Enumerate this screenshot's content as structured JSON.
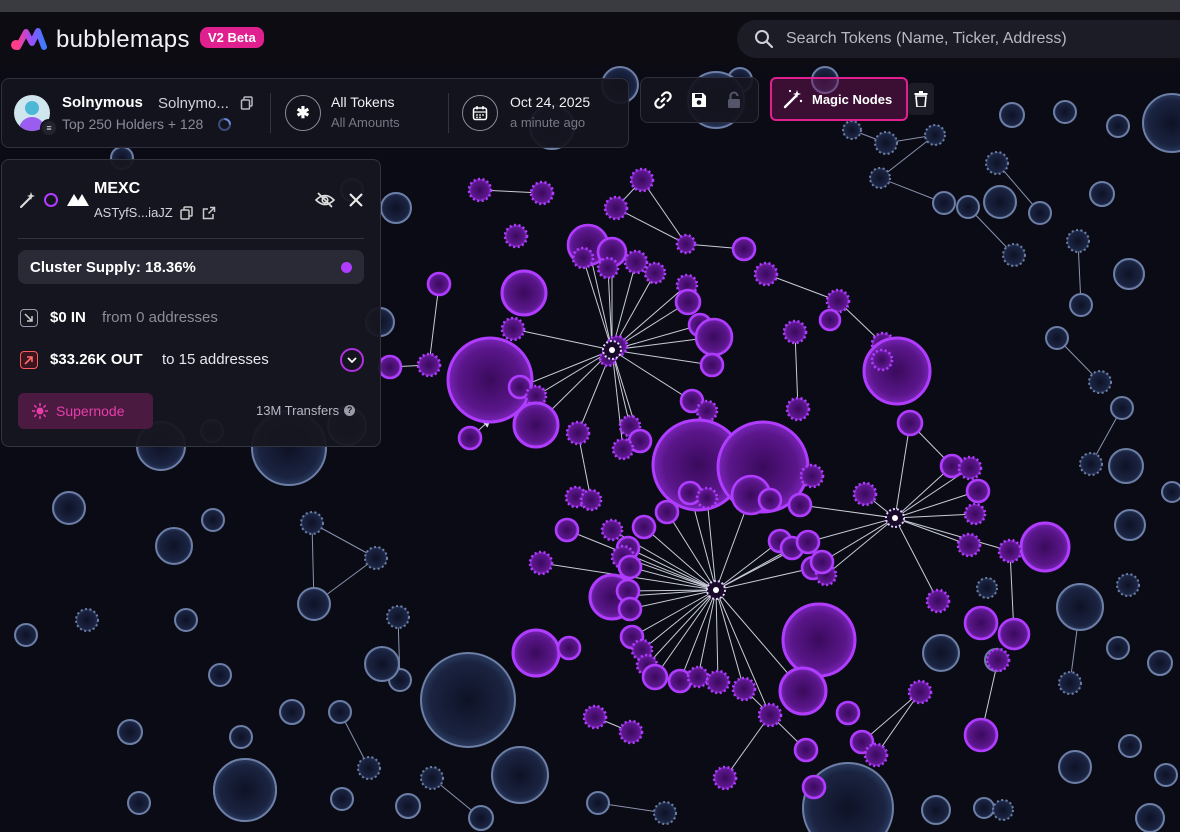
{
  "app": {
    "logo_text": "bubblemaps",
    "version_badge": "V2 Beta"
  },
  "search": {
    "placeholder": "Search Tokens (Name, Ticker, Address)"
  },
  "holders_bar": {
    "wallet_name": "Solnymous",
    "wallet_subname": "Solnymo...",
    "holders_text": "Top 250 Holders + 128",
    "tokens_title": "All Tokens",
    "tokens_sub": "All Amounts",
    "date_title": "Oct 24, 2025",
    "date_sub": "a minute ago"
  },
  "toolbar": {
    "icons": [
      "link-icon",
      "save-icon",
      "lock-icon"
    ],
    "magic_nodes_label": "Magic Nodes"
  },
  "cluster_panel": {
    "name": "MEXC",
    "address": "ASTyfS...iaJZ",
    "cluster_supply": "Cluster Supply: 18.36%",
    "in_amount": "$0 IN",
    "in_desc": "from 0 addresses",
    "out_amount": "$33.26K OUT",
    "out_desc": "to 15 addresses",
    "supernode_label": "Supernode",
    "transfers": "13M Transfers"
  },
  "colors": {
    "accent_pink": "#e0208e",
    "cluster_purple": "#b03cff",
    "node_blue": "#6d7fa6",
    "background": "#0a0b14"
  }
}
